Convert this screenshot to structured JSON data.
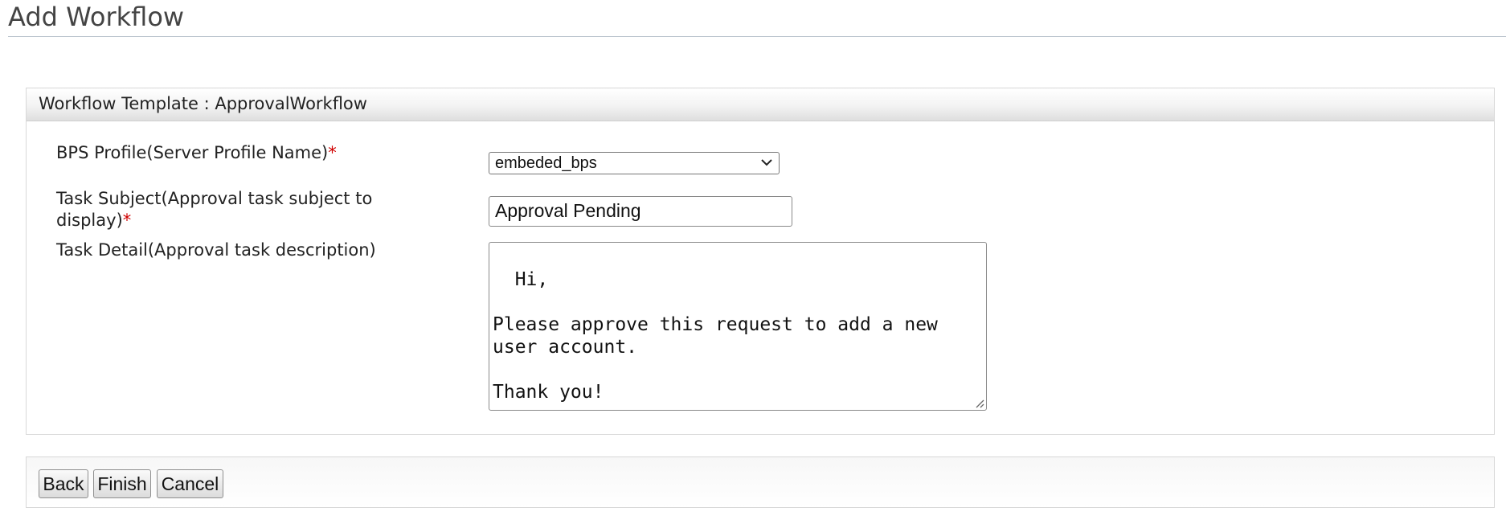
{
  "page": {
    "title": "Add Workflow"
  },
  "template": {
    "header": "Workflow Template : ApprovalWorkflow"
  },
  "form": {
    "bps_profile": {
      "label": "BPS Profile(Server Profile Name)",
      "required_mark": "*",
      "selected_value": "embeded_bps",
      "icon": "chevron-down-icon"
    },
    "task_subject": {
      "label": "Task Subject(Approval task subject to display)",
      "required_mark": "*",
      "value": "Approval Pending"
    },
    "task_detail": {
      "label": "Task Detail(Approval task description)",
      "value": "Hi,\n\nPlease approve this request to add a new user account.\n\nThank you!"
    }
  },
  "buttons": {
    "back": "Back",
    "finish": "Finish",
    "cancel": "Cancel"
  },
  "colors": {
    "required": "#d00000",
    "title_text": "#444444",
    "rule": "#b8c2cc"
  }
}
